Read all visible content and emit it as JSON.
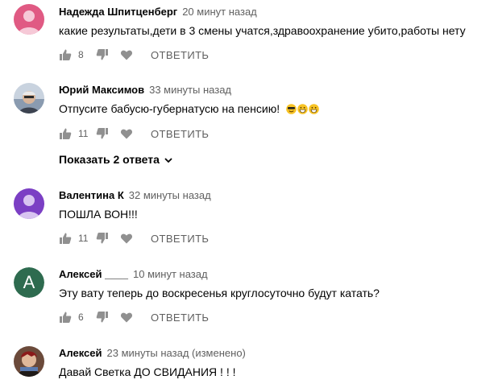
{
  "reply_label": "ОТВЕТИТЬ",
  "comments": [
    {
      "author": "Надежда Шпитценберг",
      "time": "20 минут назад",
      "text": "какие результаты,дети в 3 смены учатся,здравоохранение убито,работы нету",
      "likes": "8",
      "avatar": {
        "type": "silhouette",
        "color": "#e05a83"
      }
    },
    {
      "author": "Юрий Максимов",
      "time": "33 минуты назад",
      "text": "Отпусите бабусю-губернатусю на пенсию!",
      "emojis": [
        "smiling-face-with-sunglasses",
        "grinning-face",
        "grinning-face"
      ],
      "likes": "11",
      "avatar": {
        "type": "photo"
      }
    },
    {
      "author": "Валентина К",
      "time": "32 минуты назад",
      "text": "ПОШЛА ВОН!!!",
      "likes": "11",
      "avatar": {
        "type": "silhouette",
        "color": "#7b3fc4"
      }
    },
    {
      "author": "Алексей ____",
      "time": "10 минут назад",
      "text": "Эту вату теперь до воскресенья круглосуточно будут катать?",
      "likes": "6",
      "avatar": {
        "type": "letter",
        "letter": "А",
        "color": "#2e6b4f"
      }
    },
    {
      "author": "Алексей",
      "time": "23 минуты назад (изменено)",
      "text": "Давай Светка ДО СВИДАНИЯ ! ! !",
      "likes": "",
      "avatar": {
        "type": "photo"
      }
    }
  ],
  "show_replies": "Показать 2 ответа"
}
